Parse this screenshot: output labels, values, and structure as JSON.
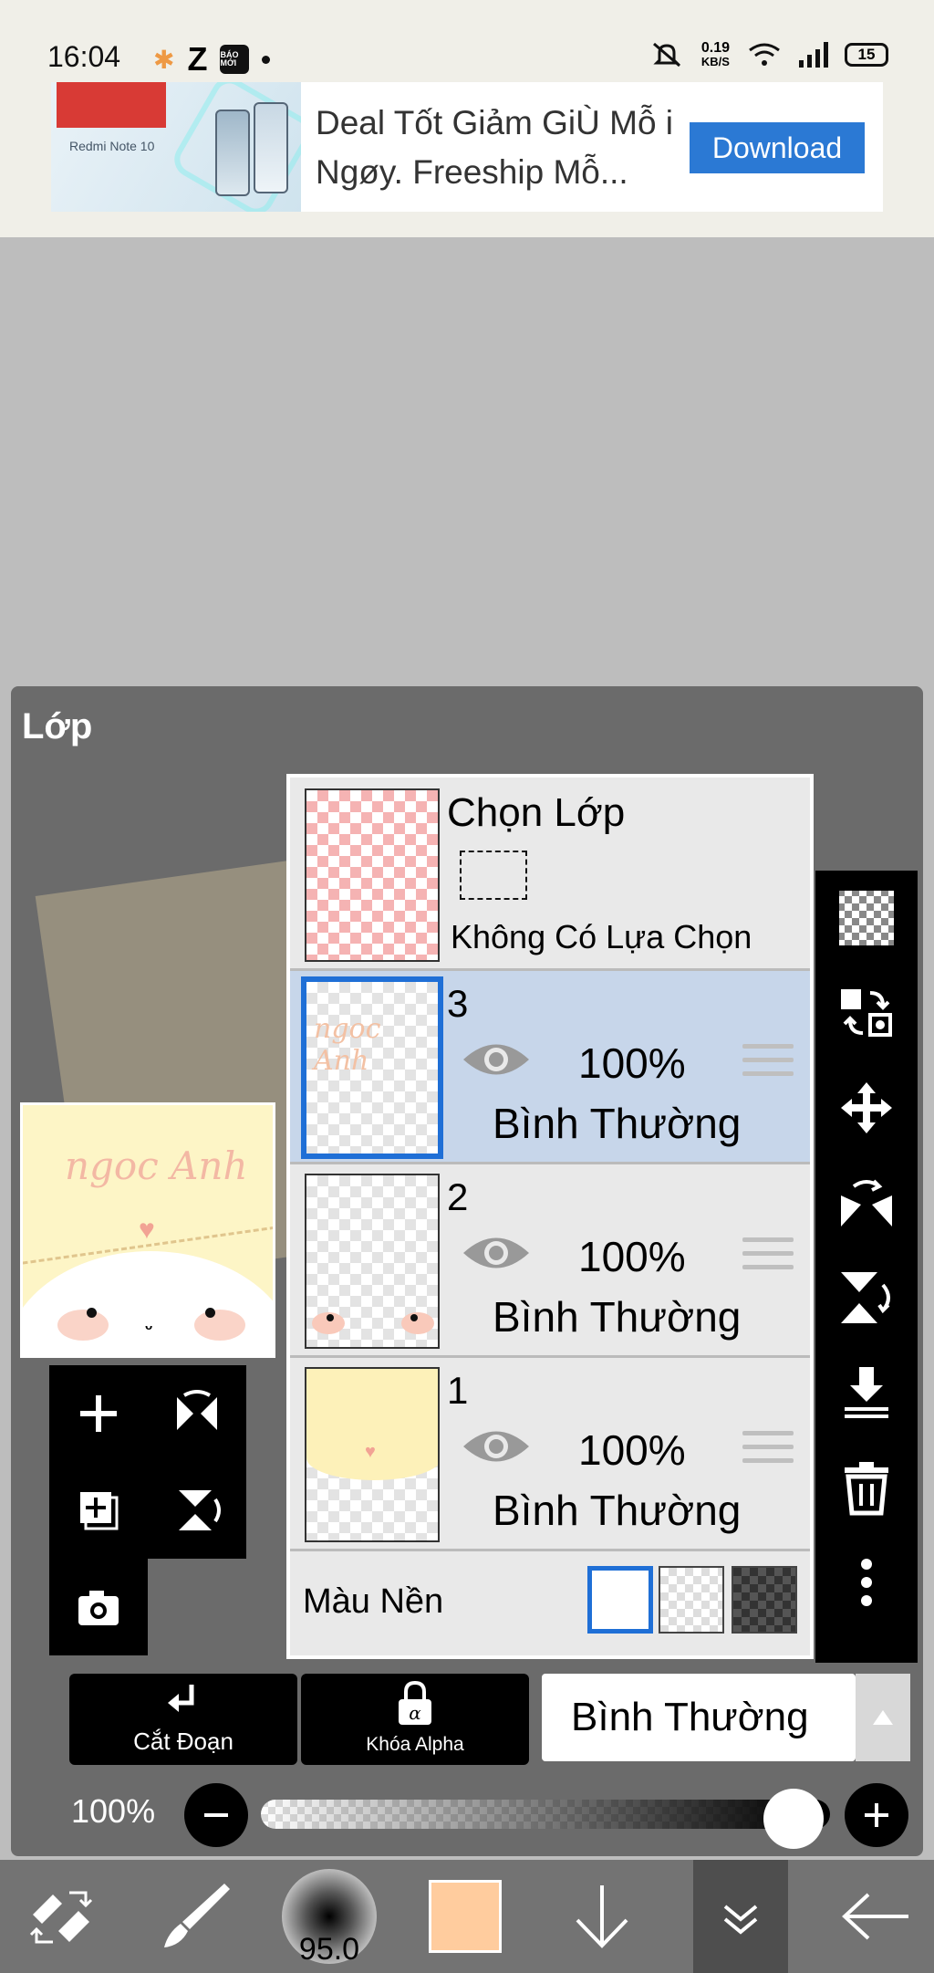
{
  "status_bar": {
    "time": "16:04",
    "left_icons": [
      "photos-icon",
      "z-icon",
      "news-icon",
      "dot"
    ],
    "news_icon_text": "BÁO MỚI",
    "speed_value": "0.19",
    "speed_unit": "KB/S",
    "battery": "15",
    "right_icons": [
      "muted-bell-icon",
      "wifi-icon",
      "signal-icon",
      "battery-icon"
    ]
  },
  "ad": {
    "text": "Deal Tốt Giảm GiÙ Mỗ i Ngøy. Freeship Mỗ...",
    "button_label": "Download",
    "button_color": "#2b79d4",
    "image_caption": "Redmi Note 10"
  },
  "panel": {
    "title": "Lớp",
    "preview_name": "ngoc Anh",
    "selection_row": {
      "title": "Chọn Lớp",
      "subtitle": "Không Có Lựa Chọn"
    },
    "layers": [
      {
        "number": "3",
        "opacity": "100%",
        "blend_mode": "Bình Thường",
        "visible": true,
        "selected": true
      },
      {
        "number": "2",
        "opacity": "100%",
        "blend_mode": "Bình Thường",
        "visible": true,
        "selected": false
      },
      {
        "number": "1",
        "opacity": "100%",
        "blend_mode": "Bình Thường",
        "visible": true,
        "selected": false
      }
    ],
    "background_row": {
      "label": "Màu Nền",
      "options": [
        "white",
        "checker",
        "dark"
      ],
      "selected": "white"
    },
    "left_tools": [
      "add-layer-icon",
      "flip-horizontal-icon",
      "duplicate-layer-icon",
      "flip-vertical-icon",
      "camera-icon"
    ],
    "side_tools": [
      "transparency-icon",
      "layer-convert-icon",
      "move-icon",
      "flip-horizontal-icon",
      "flip-vertical-icon",
      "merge-down-icon",
      "trash-icon",
      "more-icon"
    ],
    "clip_button": "Cắt Đoạn",
    "alpha_lock_button": "Khóa Alpha",
    "blend_mode_select": "Bình Thường",
    "opacity_label": "100%",
    "opacity_value": 1.0,
    "selected_color": "#1f6fd6"
  },
  "bottom_toolbar": {
    "items": [
      "tool-switch-icon",
      "brush-icon",
      "brush-size",
      "color-swatch",
      "arrow-down-icon",
      "chevron-double-down-icon",
      "back-arrow-icon"
    ],
    "brush_size": "95.0",
    "current_color": "#ffcc9e"
  }
}
